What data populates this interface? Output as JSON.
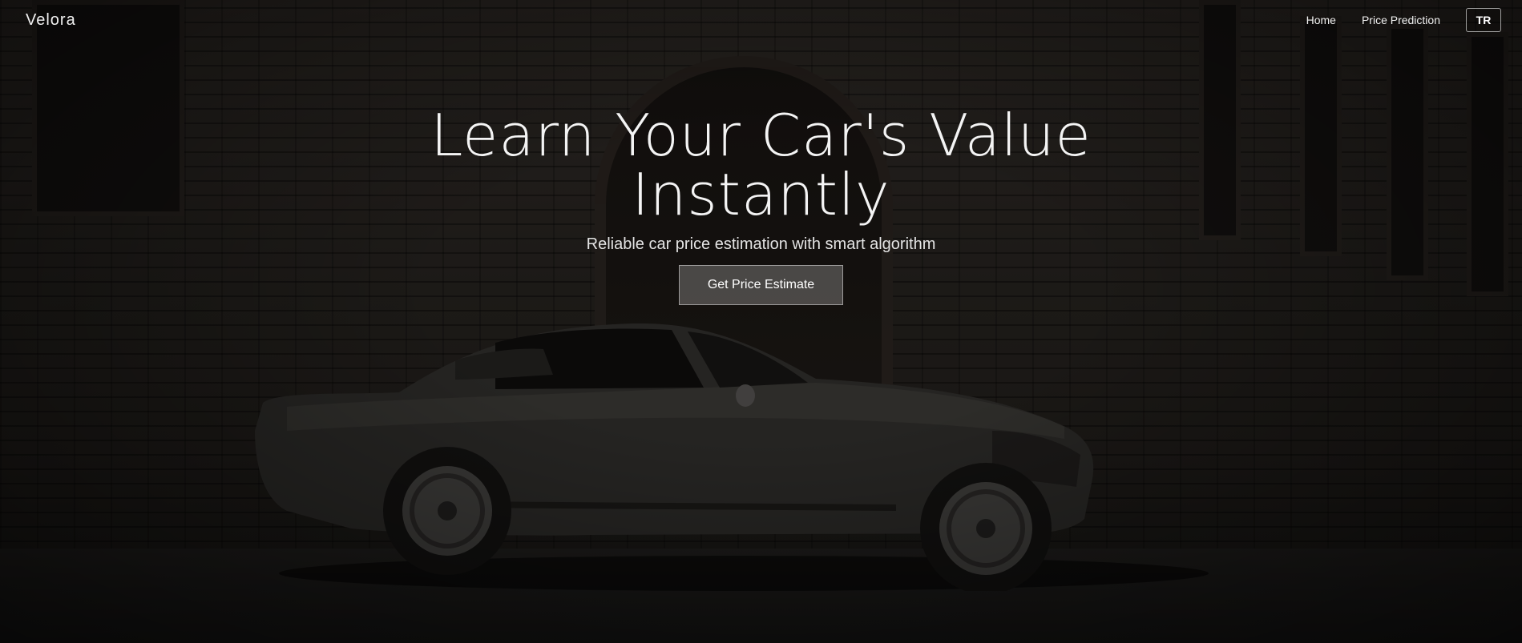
{
  "nav": {
    "brand": "Velora",
    "links": [
      {
        "label": "Home"
      },
      {
        "label": "Price Prediction"
      }
    ],
    "language": "TR"
  },
  "hero": {
    "title_line1": "Learn Your Car's Value",
    "title_line2": "Instantly",
    "subtitle": "Reliable car price estimation with smart algorithm",
    "cta_label": "Get Price Estimate"
  },
  "colors": {
    "overlay": "#000000",
    "text": "#f4f4f4",
    "button_bg": "#787674"
  }
}
